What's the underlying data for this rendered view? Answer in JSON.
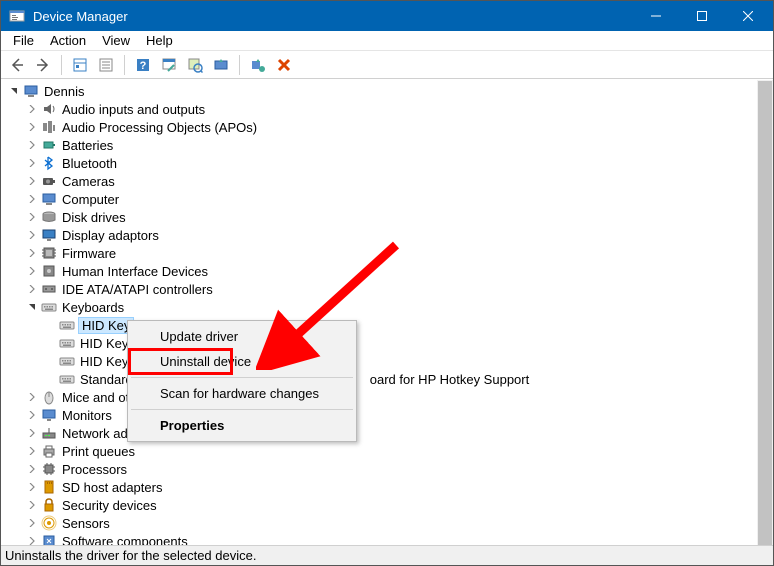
{
  "window": {
    "title": "Device Manager"
  },
  "menubar": [
    "File",
    "Action",
    "View",
    "Help"
  ],
  "root_name": "Dennis",
  "categories": [
    {
      "label": "Audio inputs and outputs",
      "icon": "speaker"
    },
    {
      "label": "Audio Processing Objects (APOs)",
      "icon": "apo"
    },
    {
      "label": "Batteries",
      "icon": "battery"
    },
    {
      "label": "Bluetooth",
      "icon": "bluetooth"
    },
    {
      "label": "Cameras",
      "icon": "camera"
    },
    {
      "label": "Computer",
      "icon": "computer"
    },
    {
      "label": "Disk drives",
      "icon": "disk"
    },
    {
      "label": "Display adaptors",
      "icon": "display"
    },
    {
      "label": "Firmware",
      "icon": "firmware"
    },
    {
      "label": "Human Interface Devices",
      "icon": "hid"
    },
    {
      "label": "IDE ATA/ATAPI controllers",
      "icon": "ide"
    },
    {
      "label": "Keyboards",
      "icon": "keyboard",
      "expanded": true,
      "children": [
        {
          "label_prefix": "HID Key",
          "selected": true
        },
        {
          "label": "HID Key"
        },
        {
          "label": "HID Key"
        },
        {
          "label": "Standard",
          "suffix": "oard for HP Hotkey Support"
        }
      ]
    },
    {
      "label": "Mice and ot",
      "icon": "mouse"
    },
    {
      "label": "Monitors",
      "icon": "monitor"
    },
    {
      "label": "Network adapters",
      "icon": "network"
    },
    {
      "label": "Print queues",
      "icon": "printer"
    },
    {
      "label": "Processors",
      "icon": "cpu"
    },
    {
      "label": "SD host adapters",
      "icon": "sd"
    },
    {
      "label": "Security devices",
      "icon": "security"
    },
    {
      "label": "Sensors",
      "icon": "sensor"
    },
    {
      "label": "Software components",
      "icon": "software"
    }
  ],
  "context_menu": {
    "items": [
      {
        "label": "Update driver"
      },
      {
        "label": "Uninstall device",
        "highlight": true
      },
      {
        "sep": true
      },
      {
        "label": "Scan for hardware changes"
      },
      {
        "sep": true
      },
      {
        "label": "Properties",
        "bold": true
      }
    ]
  },
  "statusbar": "Uninstalls the driver for the selected device."
}
